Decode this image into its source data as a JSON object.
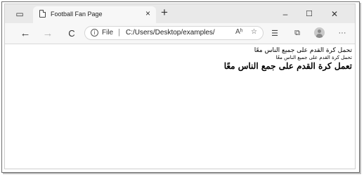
{
  "window": {
    "tab_title": "Football Fan Page",
    "tab_close": "×",
    "new_tab": "+",
    "minimize": "–",
    "maximize": "☐",
    "close": "✕",
    "tab_actions": "▭"
  },
  "nav": {
    "back": "←",
    "forward": "→",
    "reload": "C",
    "scheme_label": "File",
    "url": "C:/Users/Desktop/examples/",
    "read_aloud": "Aʰ",
    "favorite": "☆",
    "favorites": "☰",
    "collections": "⧉",
    "more": "···"
  },
  "content": {
    "line1": "تحمل كرة القدم على جميع الناس معًا",
    "line2": "تحمل كرة القدم على جميع الناس معًا",
    "line3": "تعمل كرة القدم على جمع الناس معًا"
  }
}
